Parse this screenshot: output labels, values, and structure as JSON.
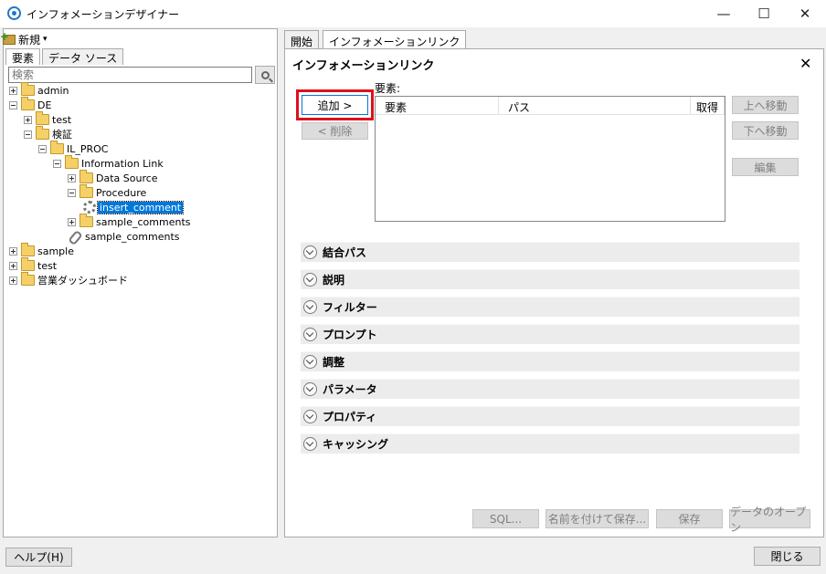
{
  "window": {
    "title": "インフォメーションデザイナー",
    "minimize_glyph": "—",
    "maximize_glyph": "☐",
    "close_glyph": "✕"
  },
  "left": {
    "new_label": "新規",
    "new_arrow": "▾",
    "tabs": [
      "要素",
      "データ ソース"
    ],
    "search_placeholder": "検索",
    "tree": [
      {
        "label": "admin"
      },
      {
        "label": "DE"
      },
      {
        "label": "test"
      },
      {
        "label": "検証"
      },
      {
        "label": "IL_PROC"
      },
      {
        "label": "Information Link"
      },
      {
        "label": "Data Source"
      },
      {
        "label": "Procedure"
      },
      {
        "label": "insert_comment"
      },
      {
        "label": "sample_comments"
      },
      {
        "label": "sample_comments"
      },
      {
        "label": "sample"
      },
      {
        "label": "test"
      },
      {
        "label": "営業ダッシュボード"
      }
    ]
  },
  "right": {
    "tabs": [
      "開始",
      "インフォメーションリンク"
    ],
    "section_title": "インフォメーションリンク",
    "close_glyph": "✕",
    "elements_label": "要素:",
    "add_label": "追加 >",
    "remove_label": "< 削除",
    "columns": [
      "要素",
      "パス",
      "取得"
    ],
    "move_up_label": "上へ移動",
    "move_down_label": "下へ移動",
    "edit_label": "編集",
    "sections": [
      "結合パス",
      "説明",
      "フィルター",
      "プロンプト",
      "調整",
      "パラメータ",
      "プロパティ",
      "キャッシング"
    ],
    "sql_label": "SQL...",
    "save_as_label": "名前を付けて保存...",
    "save_label": "保存",
    "open_data_label": "データのオープン"
  },
  "footer": {
    "help_label": "ヘルプ(H)",
    "close_label": "閉じる"
  }
}
